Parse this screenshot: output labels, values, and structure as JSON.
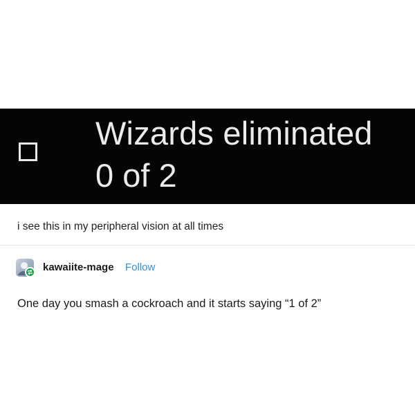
{
  "banner": {
    "title": "Wizards eliminated",
    "progress": "0 of 2",
    "checkbox_icon": "empty-checkbox-icon",
    "background": "#050505",
    "text_color": "#ebebeb"
  },
  "post": {
    "caption": "i see this in my peripheral vision at all times"
  },
  "reply": {
    "username": "kawaiite-mage",
    "follow_label": "Follow",
    "body": "One day you smash a cockroach and it starts saying “1 of 2”",
    "avatar_icon": "user-avatar-icon",
    "badge_icon": "reblog-icon",
    "follow_color": "#2e8fdc",
    "badge_color": "#17a34a"
  }
}
